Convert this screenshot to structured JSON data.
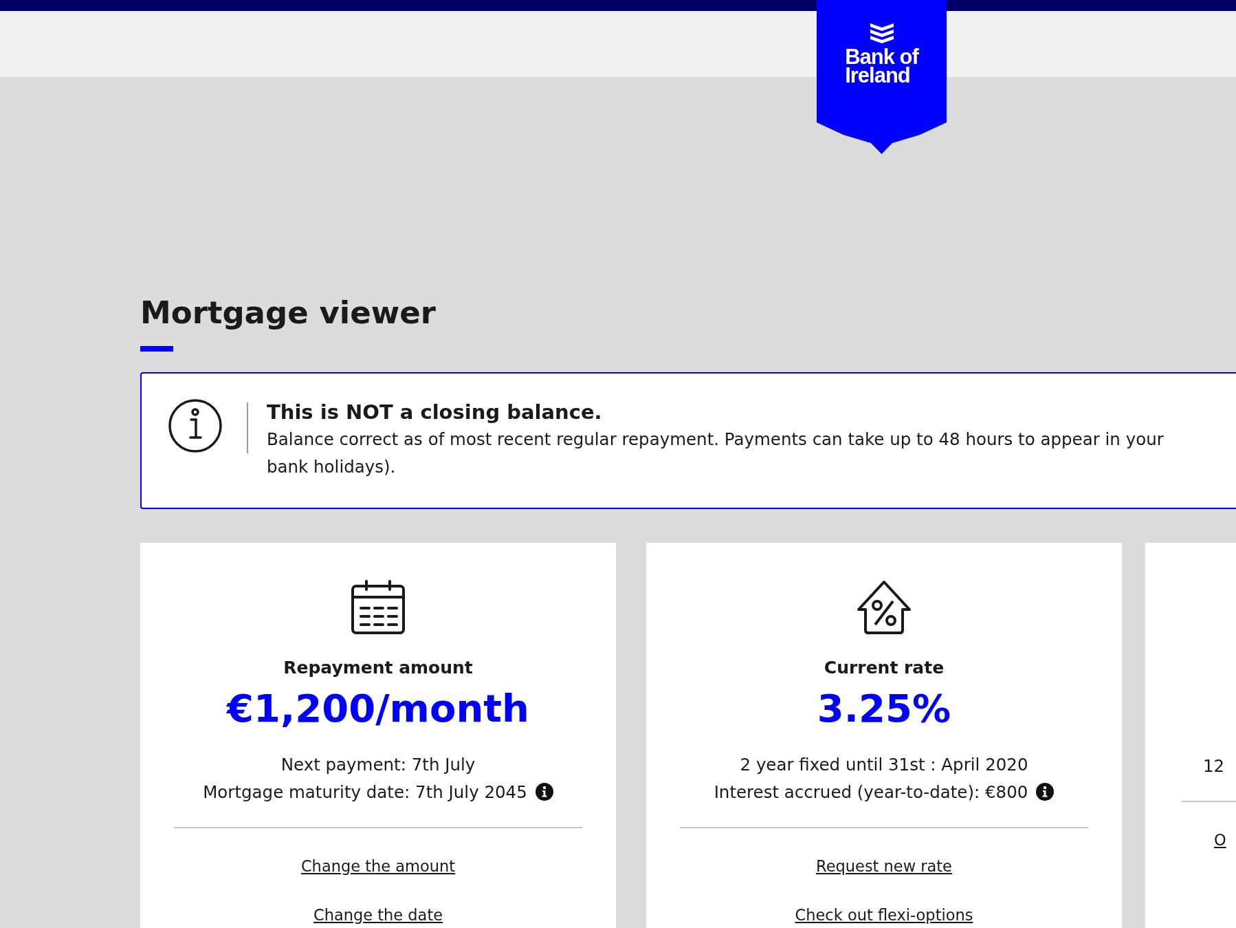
{
  "header": {
    "logo": {
      "lines": [
        "Bank of",
        "Ireland"
      ]
    }
  },
  "page_title": "Mortgage viewer",
  "notice": {
    "title": "This is NOT a closing balance.",
    "body_lines": [
      "Balance correct as of most recent regular repayment. Payments can take up to 48 hours to appear in your",
      "bank holidays)."
    ]
  },
  "cards": [
    {
      "kind": "payment",
      "title": "Repayment amount",
      "value": "€1,200/month",
      "details": [
        {
          "text": "Next payment: 7th July",
          "info": false
        },
        {
          "text": "Mortgage maturity date: 7th July 2045",
          "info": true
        }
      ],
      "links": [
        "Change the amount",
        "Change the date"
      ]
    },
    {
      "kind": "rate",
      "title": "Current rate",
      "value": "3.25%",
      "details": [
        {
          "text": "2 year fixed until 31st : April 2020",
          "info": false
        },
        {
          "text": "Interest accrued (year-to-date): €800",
          "info": true
        }
      ],
      "links": [
        "Request new rate",
        "Check out flexi-options"
      ]
    },
    {
      "kind": "partial",
      "details": [
        {
          "text": "12",
          "info": false
        }
      ],
      "links": [
        "O"
      ]
    }
  ]
}
